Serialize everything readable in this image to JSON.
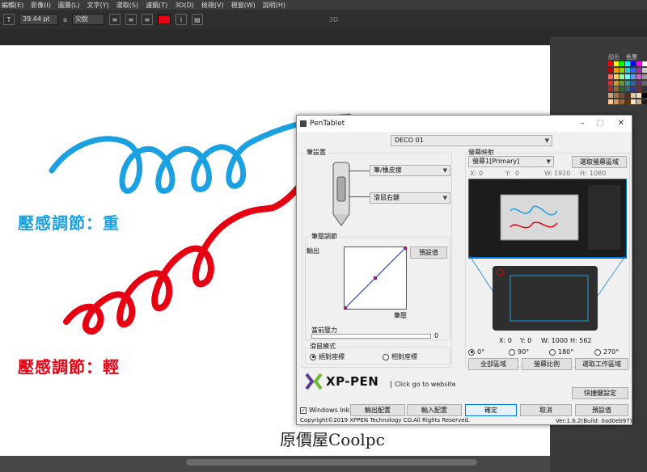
{
  "photoshop": {
    "menu": [
      "編輯(E)",
      "影像(I)",
      "圖層(L)",
      "文字(Y)",
      "選取(S)",
      "濾鏡(T)",
      "3D(D)",
      "檢視(V)",
      "視窗(W)",
      "說明(H)"
    ],
    "options": {
      "font_size": "39.44 pt",
      "aa": "a",
      "aa_mode": "尖銳",
      "label_3d": "3D"
    },
    "swatches_tab": "色票",
    "swatches_tab2": "顏色"
  },
  "canvas": {
    "label_heavy": "壓感調節：重",
    "label_light": "壓感調節：輕",
    "watermark": "原價屋Coolpc",
    "label_heavy_color": "#1ba1e2",
    "label_light_color": "#e60012"
  },
  "dialog": {
    "title": "PenTablet",
    "device": "DECO 01",
    "pen": {
      "group": "筆設置",
      "upper_button": "筆/橡皮擦",
      "lower_button": "滑鼠右鍵",
      "pressure_group": "筆壓調節",
      "output_label": "輸出",
      "pressure_label": "筆壓",
      "default_button": "預設值",
      "current_pressure_label": "當前壓力",
      "current_pressure_value": "0",
      "mouse_mode_group": "滑鼠模式",
      "absolute": "絕對座標",
      "relative": "相對座標",
      "mode_selected": "absolute"
    },
    "mapping": {
      "group": "螢幕映射",
      "monitor": "螢幕1[Primary]",
      "select_area_button": "選取螢幕區域",
      "x_label": "X:",
      "x_value": "0",
      "y_label": "Y:",
      "y_value": "0",
      "w_label": "W:",
      "w_value": "1920",
      "h_label": "H:",
      "h_value": "1080",
      "tab_x": "X: 0",
      "tab_y": "Y: 0",
      "tab_w": "W: 1000",
      "tab_h": "H: 562",
      "rotations": [
        "0°",
        "90°",
        "180°",
        "270°"
      ],
      "rotation_selected": "0°",
      "full_area_button": "全部區域",
      "screen_ratio_button": "螢幕比例",
      "work_area_button": "選取工作區域"
    },
    "brand": {
      "logo_text": "XP-PEN",
      "website": "Click go to website"
    },
    "shortcut_button": "快捷鍵設定",
    "windows_ink": "Windows Ink",
    "windows_ink_checked": true,
    "export_button": "輸出配置",
    "import_button": "輸入配置",
    "ok_button": "確定",
    "cancel_button": "取消",
    "default_button": "預設值",
    "copyright": "Copyright©2019  XPPEN Technology CO.All Rights Reserved.",
    "version": "Ver:1.6.2(Build: 0ad0eb97)"
  },
  "colors": {
    "accent_blue": "#1ba1e2",
    "accent_red": "#e60012",
    "selection_blue": "#0078d7"
  }
}
